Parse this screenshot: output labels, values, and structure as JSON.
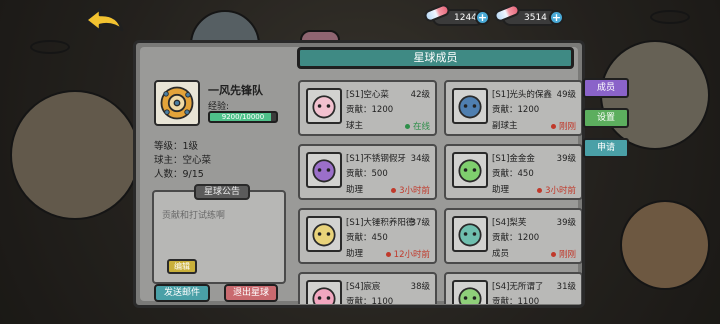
{
  "resources": {
    "gems": {
      "value": "12440k",
      "icon": "crystal-icon"
    },
    "coins": {
      "value": "3514",
      "icon": "crystal-icon"
    }
  },
  "team": {
    "name": "一风先锋队",
    "exp_label": "经验:",
    "exp_text": "9200/10000",
    "exp_fraction": 0.92,
    "level": "等级：1级",
    "owner": "球主：空心菜",
    "members": "人数：9/15"
  },
  "notice": {
    "title": "星球公告",
    "text": "贡献和打试练啊",
    "edit": "编辑"
  },
  "buttons": {
    "send_mail": "发送邮件",
    "quit_planet": "退出星球"
  },
  "list_title": "星球成员",
  "side_tabs": {
    "members": "成员",
    "settings": "设置",
    "apply": "申请"
  },
  "members": [
    {
      "name": "[S1]空心菜",
      "level": "42级",
      "contrib": "贡献：1200",
      "role": "球主",
      "status": "在线",
      "status_color": "#2e8f4a"
    },
    {
      "name": "[S1]光头的保鑫",
      "level": "49级",
      "contrib": "贡献：1200",
      "role": "副球主",
      "status": "刚刚",
      "status_color": "#c0392b"
    },
    {
      "name": "[S1]不锈钢假牙",
      "level": "34级",
      "contrib": "贡献：500",
      "role": "助理",
      "status": "3小时前",
      "status_color": "#c0392b"
    },
    {
      "name": "[S1]金金金",
      "level": "39级",
      "contrib": "贡献：450",
      "role": "助理",
      "status": "3小时前",
      "status_color": "#c0392b"
    },
    {
      "name": "[S1]大锤积养阳德",
      "level": "37级",
      "contrib": "贡献：450",
      "role": "助理",
      "status": "12小时前",
      "status_color": "#c0392b"
    },
    {
      "name": "[S4]梨芙",
      "level": "39级",
      "contrib": "贡献：1200",
      "role": "成员",
      "status": "刚刚",
      "status_color": "#c0392b"
    },
    {
      "name": "[S4]宸宸",
      "level": "38级",
      "contrib": "贡献：1100",
      "role": "",
      "status": "",
      "status_color": "#c0392b"
    },
    {
      "name": "[S4]无所谓了",
      "level": "31级",
      "contrib": "贡献：1100",
      "role": "",
      "status": "",
      "status_color": "#c0392b"
    }
  ]
}
